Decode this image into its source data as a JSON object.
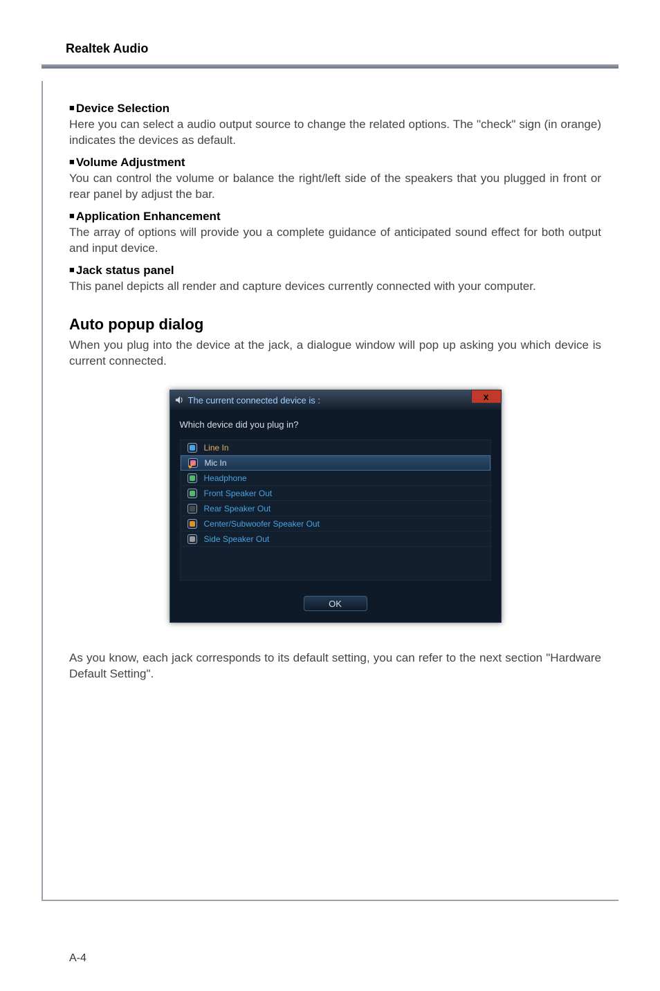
{
  "header": {
    "title": "Realtek Audio"
  },
  "sections": {
    "deviceSelection": {
      "title": "Device Selection",
      "body": "Here you can select a audio output source to change the related options. The \"check\" sign (in orange) indicates the devices as default."
    },
    "volumeAdjustment": {
      "title": "Volume Adjustment",
      "body": "You can control the volume or balance the right/left side of the speakers that you plugged in front or rear panel by adjust the bar."
    },
    "applicationEnhancement": {
      "title": "Application Enhancement",
      "body": "The array of options will provide you a complete guidance of anticipated sound effect for both output and input device."
    },
    "jackStatus": {
      "title": "Jack status panel",
      "body": "This panel depicts all render and capture devices currently connected with your computer."
    },
    "autoPopup": {
      "heading": "Auto popup dialog",
      "body": "When you plug into the device at the jack, a dialogue window will pop up asking you which device is current connected.",
      "afterBody": "As you know, each jack corresponds to its default setting, you can refer to the next section \"Hardware Default Setting\"."
    }
  },
  "dialog": {
    "title": "The current connected device is :",
    "prompt": "Which device did you plug in?",
    "closeLabel": "x",
    "okLabel": "OK",
    "devices": {
      "linein": "Line In",
      "micin": "Mic In",
      "headphone": "Headphone",
      "frontspk": "Front Speaker Out",
      "rearspk": "Rear Speaker Out",
      "center": "Center/Subwoofer Speaker Out",
      "sidespk": "Side Speaker Out"
    },
    "selected": "micin"
  },
  "pageNumber": "A-4"
}
